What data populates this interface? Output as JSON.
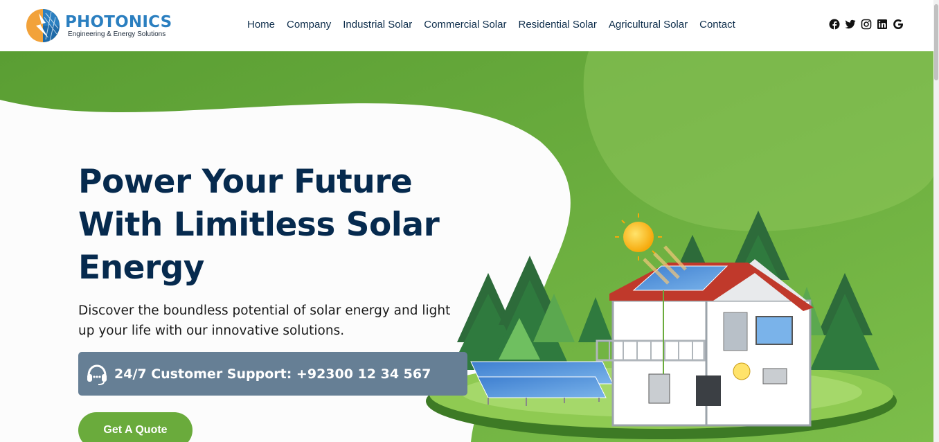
{
  "brand": {
    "name": "PHOTONICS",
    "tagline": "Engineering & Energy Solutions",
    "colors": {
      "primary": "#2b7fc0",
      "accent": "#f2a23a",
      "dark": "#062a4e",
      "green": "#6aab3c"
    }
  },
  "nav": {
    "items": [
      {
        "label": "Home"
      },
      {
        "label": "Company"
      },
      {
        "label": "Industrial Solar"
      },
      {
        "label": "Commercial Solar"
      },
      {
        "label": "Residential Solar"
      },
      {
        "label": "Agricultural Solar"
      },
      {
        "label": "Contact"
      }
    ]
  },
  "social": [
    "facebook-icon",
    "twitter-icon",
    "instagram-icon",
    "linkedin-icon",
    "google-icon"
  ],
  "hero": {
    "headline": "Power Your Future With Limitless Solar Energy",
    "subline": "Discover the boundless potential of solar energy and light up your life with our innovative solutions.",
    "support_text": "24/7 Customer Support: +92300 12 34 567",
    "cta_label": "Get A Quote"
  }
}
